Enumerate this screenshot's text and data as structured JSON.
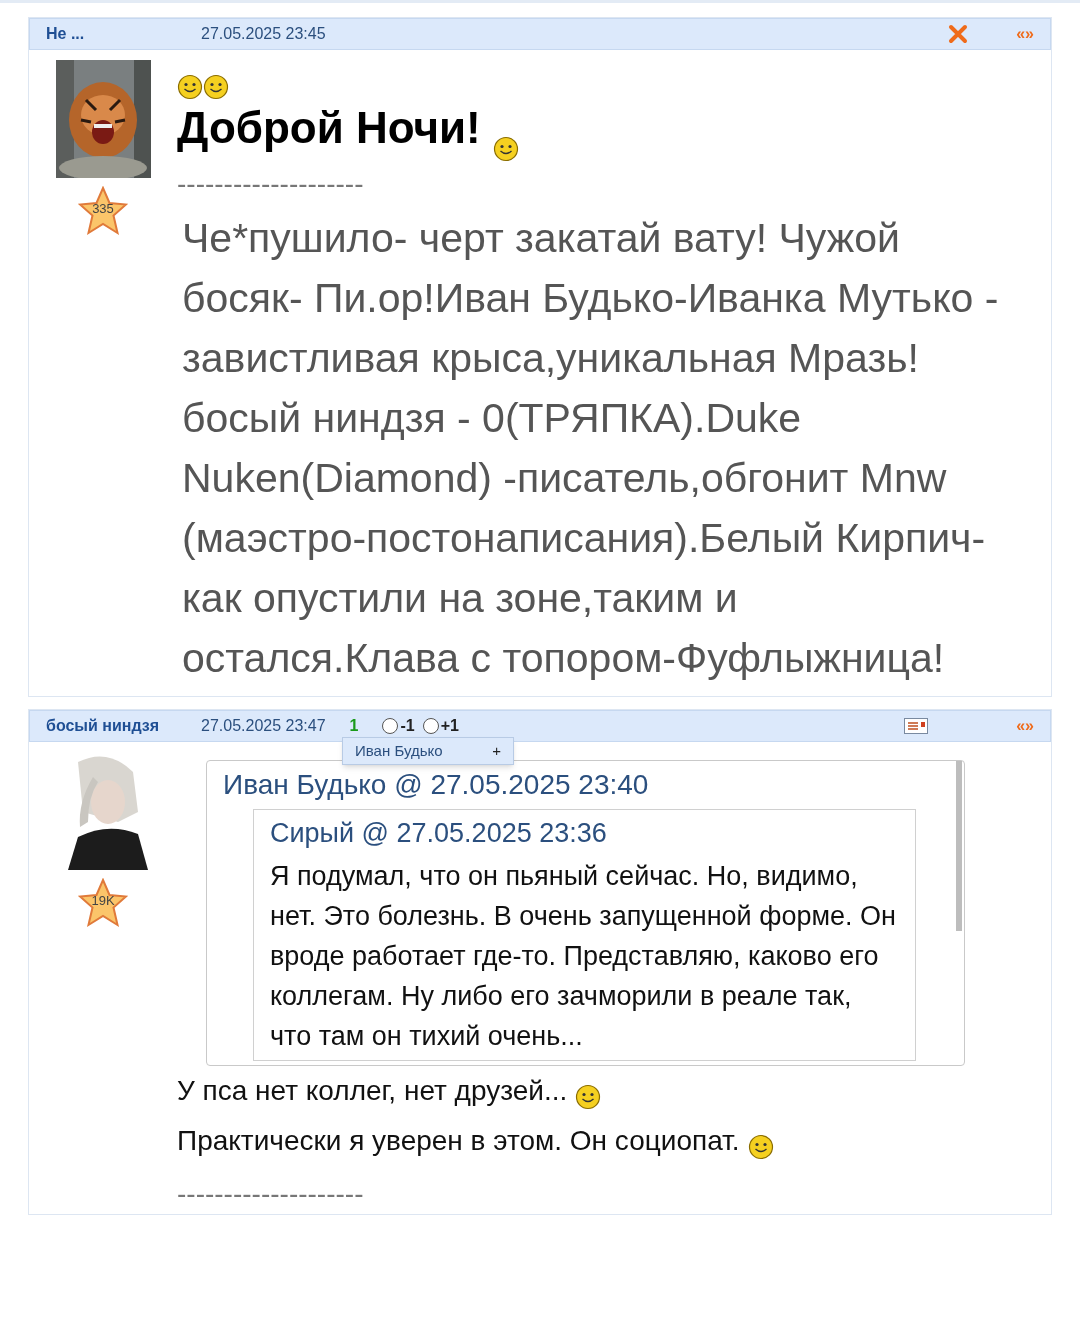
{
  "posts": [
    {
      "author": "Не ...",
      "time": "27.05.2025 23:45",
      "delete_button": true,
      "quote_link": "«»",
      "rank": "335",
      "blocks": [
        {
          "kind": "smileys"
        },
        {
          "kind": "heading",
          "text": "Доброй Ночи!",
          "smiley": true
        },
        {
          "kind": "divider",
          "text": "--------------------"
        },
        {
          "kind": "bigtext",
          "text": "Че*пушило- черт закатай вату! Чужой босяк- Пи.ор!Иван Будько-Иванка Мутько - завистливая крыса,уникальная Мразь!босый ниндзя - 0(ТРЯПКА).Duke Nuken(Diamond) -писатель,обгонит Mnw (маэстро-постонаписания).Белый Кирпич- как опустили на зоне,таким и остался.Клава с топором-Фуфлыжница!"
        }
      ]
    },
    {
      "author": "босый ниндзя",
      "time": "27.05.2025 23:47",
      "delete_button": false,
      "score": "1",
      "votes": [
        {
          "label": "-1",
          "selected": false
        },
        {
          "label": "+1",
          "selected": false
        }
      ],
      "popup": {
        "name": "Иван Будько",
        "action": "+"
      },
      "card_icon": true,
      "quote_link": "«»",
      "rank": "19K",
      "blocks": [
        {
          "kind": "quote",
          "author": "Иван Будько",
          "separator": "@",
          "time": "27.05.2025 23:40",
          "inner": {
            "author": "Сирый",
            "separator": "@",
            "time": "27.05.2025 23:36",
            "text": "Я подумал, что он пьяный сейчас. Но, видимо, нет. Это болезнь. В очень запущенной форме. Он вроде работает где-то. Представляю, каково его коллегам. Ну либо его зачморили в реале так, что там он тихий очень..."
          }
        },
        {
          "kind": "text",
          "text": "У пса нет коллег, нет друзей...",
          "smiley": true
        },
        {
          "kind": "text",
          "text": "Практически я уверен в этом. Он социопат.",
          "smiley": true
        },
        {
          "kind": "divider",
          "text": "--------------------"
        }
      ]
    }
  ]
}
